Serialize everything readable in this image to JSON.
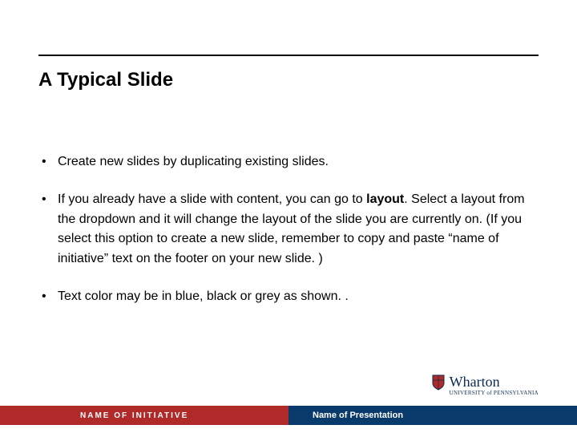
{
  "title": "A Typical Slide",
  "bullets": [
    {
      "pre": "Create new slides by duplicating existing slides.",
      "bold": "",
      "post": ""
    },
    {
      "pre": "If you already have a slide with content, you can go to ",
      "bold": "layout",
      "post": ". Select a layout from the dropdown and it will change the layout of the slide you are currently on. (If you select this option to create a new slide, remember to copy and paste “name of initiative” text on the footer on your new slide. )"
    },
    {
      "pre": "Text color may be in blue, black or grey as shown. .",
      "bold": "",
      "post": ""
    }
  ],
  "footer": {
    "left": "NAME OF INITIATIVE",
    "right": "Name of Presentation"
  },
  "logo": {
    "wordmark": "Wharton",
    "subline": "UNIVERSITY of PENNSYLVANIA"
  },
  "colors": {
    "footer_red": "#b02a2a",
    "footer_blue": "#083a6b",
    "logo_navy": "#0a2a52"
  }
}
